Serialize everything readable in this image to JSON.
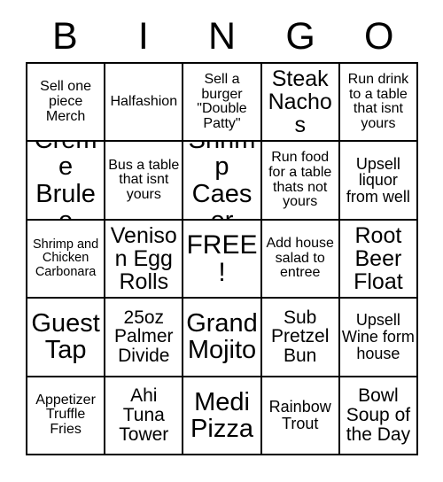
{
  "card": {
    "title_letters": [
      "B",
      "I",
      "N",
      "G",
      "O"
    ],
    "free_space_label": "FREE!",
    "colors": {
      "background": "#ffffff",
      "text": "#000000",
      "border": "#000000"
    },
    "rows": [
      [
        {
          "text": "Sell one piece Merch",
          "size": "s"
        },
        {
          "text": "Halfashion",
          "size": "s"
        },
        {
          "text": "Sell a burger \"Double Patty\"",
          "size": "s"
        },
        {
          "text": "Steak Nachos",
          "size": "xl"
        },
        {
          "text": "Run drink to a table that isnt yours",
          "size": "s"
        }
      ],
      [
        {
          "text": "Creme Brulee",
          "size": "xxl"
        },
        {
          "text": "Bus a table that isnt yours",
          "size": "s"
        },
        {
          "text": "Shrimp Caeser",
          "size": "xxl"
        },
        {
          "text": "Run food for a table thats not yours",
          "size": "s"
        },
        {
          "text": "Upsell liquor from well",
          "size": "m"
        }
      ],
      [
        {
          "text": "Shrimp and Chicken Carbonara",
          "size": "xs"
        },
        {
          "text": "Venison Egg Rolls",
          "size": "xl"
        },
        {
          "text": "FREE!",
          "size": "free"
        },
        {
          "text": "Add house salad to entree",
          "size": "s"
        },
        {
          "text": "Root Beer Float",
          "size": "xl"
        }
      ],
      [
        {
          "text": "Guest Tap",
          "size": "xxl"
        },
        {
          "text": "25oz Palmer Divide",
          "size": "l"
        },
        {
          "text": "Grand Mojito",
          "size": "xxl"
        },
        {
          "text": "Sub Pretzel Bun",
          "size": "l"
        },
        {
          "text": "Upsell Wine form house",
          "size": "m"
        }
      ],
      [
        {
          "text": "Appetizer Truffle Fries",
          "size": "s"
        },
        {
          "text": "Ahi Tuna Tower",
          "size": "l"
        },
        {
          "text": "Medi Pizza",
          "size": "xxl"
        },
        {
          "text": "Rainbow Trout",
          "size": "m"
        },
        {
          "text": "Bowl Soup of the Day",
          "size": "l"
        }
      ]
    ]
  }
}
